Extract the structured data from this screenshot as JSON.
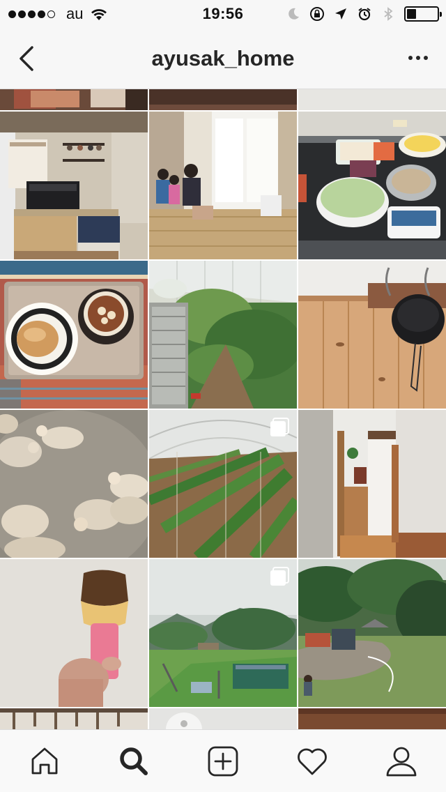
{
  "status_bar": {
    "carrier": "au",
    "time": "19:56",
    "signal_bars_filled": 4,
    "signal_bars_total": 5,
    "battery_level": 0.25,
    "icons": [
      "wifi-icon",
      "moon-icon",
      "rotation-lock-icon",
      "location-arrow-icon",
      "alarm-icon",
      "bluetooth-icon",
      "battery-icon"
    ]
  },
  "nav": {
    "title": "ayusak_home",
    "back_icon": "chevron-left-icon",
    "more_icon": "more-dots-icon"
  },
  "grid": {
    "tiles": [
      {
        "subject": "kitchen-top-partial",
        "multiple": false
      },
      {
        "subject": "floor-top-partial",
        "multiple": false
      },
      {
        "subject": "wall-top-partial",
        "multiple": false
      },
      {
        "subject": "kitchen",
        "multiple": false
      },
      {
        "subject": "children-on-tatami",
        "multiple": false
      },
      {
        "subject": "vegetables-prep",
        "multiple": false
      },
      {
        "subject": "bread-and-tea-tray",
        "multiple": false
      },
      {
        "subject": "tomato-greenhouse",
        "multiple": false
      },
      {
        "subject": "hat-on-wood-wall",
        "multiple": false
      },
      {
        "subject": "sheep-flock",
        "multiple": false
      },
      {
        "subject": "greenhouse-rows",
        "multiple": true
      },
      {
        "subject": "hallway-interior",
        "multiple": false
      },
      {
        "subject": "pudding-popsicle",
        "multiple": false
      },
      {
        "subject": "park-playground",
        "multiple": true
      },
      {
        "subject": "campsite-lawn",
        "multiple": false
      },
      {
        "subject": "shelf-bottom-partial",
        "multiple": false
      },
      {
        "subject": "lamp-bottom-partial",
        "multiple": false
      },
      {
        "subject": "wood-bottom-partial",
        "multiple": false
      }
    ]
  },
  "tab_bar": {
    "tabs": [
      {
        "name": "home",
        "icon": "home-icon",
        "active": false
      },
      {
        "name": "search",
        "icon": "search-icon",
        "active": true
      },
      {
        "name": "new-post",
        "icon": "add-post-icon",
        "active": false
      },
      {
        "name": "activity",
        "icon": "heart-icon",
        "active": false
      },
      {
        "name": "profile",
        "icon": "profile-icon",
        "active": false
      }
    ]
  },
  "colors": {
    "bar_background": "#f7f7f7",
    "icon_color": "#262626",
    "divider": "#dcdcdc"
  }
}
